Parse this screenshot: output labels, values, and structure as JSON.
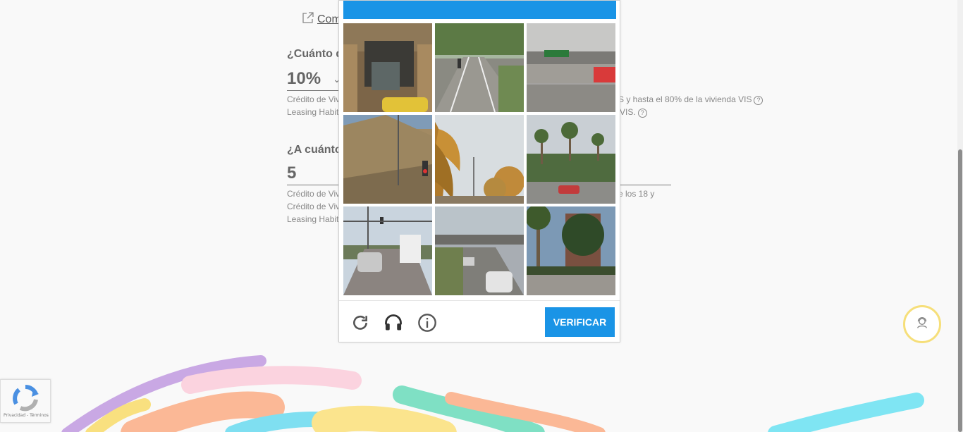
{
  "page": {
    "top_link": "Com",
    "q1_label": "¿Cuánto d",
    "q1_value": "10%",
    "q1_help1_left": "Crédito de Viv",
    "q1_help1_right": "S y hasta el 80% de la vivienda VIS",
    "q1_help2_left": "Leasing Habit",
    "q1_help2_right": "VIS.",
    "q2_label": "¿A cuánto",
    "q2_value": "5",
    "q2_help1_left": "Crédito de Viv",
    "q2_help1_right": "e los 18 y",
    "q2_help2_left": "Crédito de Viv",
    "q2_help3_left": "Leasing Habit"
  },
  "captcha": {
    "verify_label": "VERIFICAR",
    "header_color": "#1a94e6",
    "tiles": [
      {
        "name": "tile-storefront"
      },
      {
        "name": "tile-bike-path"
      },
      {
        "name": "tile-overpass"
      },
      {
        "name": "tile-hillside"
      },
      {
        "name": "tile-palm-tree"
      },
      {
        "name": "tile-palm-street"
      },
      {
        "name": "tile-intersection-truck"
      },
      {
        "name": "tile-freeway-overpass"
      },
      {
        "name": "tile-palm-sidewalk"
      }
    ]
  },
  "recaptcha_badge": {
    "text": "Privacidad - Términos"
  },
  "support": {
    "icon": "support-agent-icon"
  }
}
